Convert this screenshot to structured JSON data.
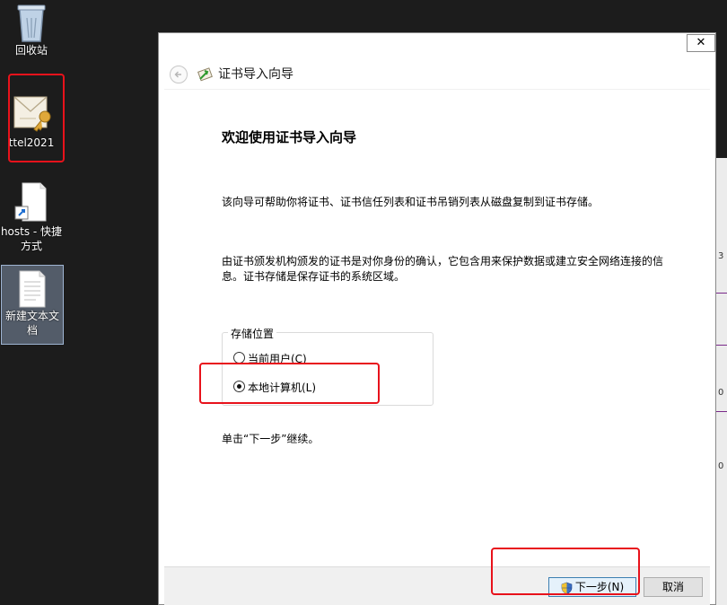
{
  "desktop": {
    "icons": [
      {
        "label": "回收站"
      },
      {
        "label": "ttel2021"
      },
      {
        "label": "hosts - 快捷方式"
      },
      {
        "label": "新建文本文档"
      }
    ]
  },
  "background_window": {
    "tick_labels": [
      "3",
      "0",
      "0"
    ]
  },
  "wizard": {
    "title": "证书导入向导",
    "close_glyph": "✕",
    "heading": "欢迎使用证书导入向导",
    "paragraph1": "该向导可帮助你将证书、证书信任列表和证书吊销列表从磁盘复制到证书存储。",
    "paragraph2": "由证书颁发机构颁发的证书是对你身份的确认，它包含用来保护数据或建立安全网络连接的信息。证书存储是保存证书的系统区域。",
    "store_location": {
      "label": "存储位置",
      "options": [
        {
          "label": "当前用户(C)",
          "checked": false
        },
        {
          "label": "本地计算机(L)",
          "checked": true
        }
      ]
    },
    "continue_text": "单击“下一步”继续。",
    "buttons": {
      "next": "下一步(N)",
      "cancel": "取消"
    }
  },
  "colors": {
    "highlight": "#e8121b",
    "accent": "#3c7fb1"
  }
}
